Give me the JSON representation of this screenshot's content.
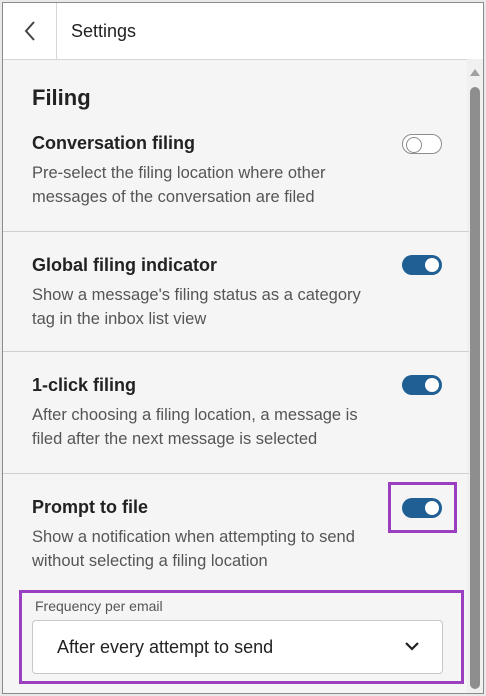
{
  "header": {
    "back_icon": "chevron-left-icon",
    "title": "Settings"
  },
  "section": {
    "title": "Filing"
  },
  "items": [
    {
      "title": "Conversation filing",
      "description": "Pre-select the filing location where other messages of the conversation are filed",
      "enabled": false
    },
    {
      "title": "Global filing indicator",
      "description": "Show a message's filing status as a category tag in the inbox list view",
      "enabled": true
    },
    {
      "title": "1-click filing",
      "description": "After choosing a filing location, a message is filed after the next message is selected",
      "enabled": true
    },
    {
      "title": "Prompt to file",
      "description": "Show a notification when attempting to send without selecting a filing location",
      "enabled": true
    }
  ],
  "frequency": {
    "label": "Frequency per email",
    "selected": "After every attempt to send",
    "icon": "chevron-down-icon"
  },
  "colors": {
    "toggle_on": "#1f5f93",
    "highlight": "#9b3fc1"
  }
}
